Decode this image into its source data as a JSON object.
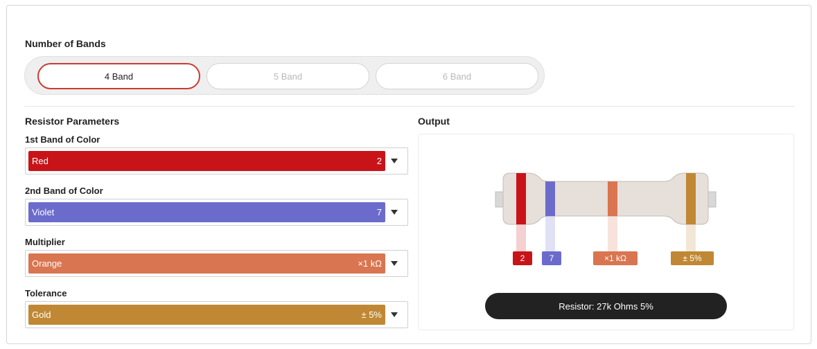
{
  "bands_section": {
    "title": "Number of Bands",
    "options": [
      {
        "label": "4 Band",
        "active": true
      },
      {
        "label": "5 Band",
        "active": false
      },
      {
        "label": "6 Band",
        "active": false
      }
    ]
  },
  "params": {
    "title": "Resistor Parameters",
    "fields": [
      {
        "label": "1st Band of Color",
        "color_name": "Red",
        "value": "2",
        "color": "#c81419"
      },
      {
        "label": "2nd Band of Color",
        "color_name": "Violet",
        "value": "7",
        "color": "#6b6bcc"
      },
      {
        "label": "Multiplier",
        "color_name": "Orange",
        "value": "×1 kΩ",
        "color": "#d97550"
      },
      {
        "label": "Tolerance",
        "color_name": "Gold",
        "value": "± 5%",
        "color": "#c08834"
      }
    ]
  },
  "output": {
    "title": "Output",
    "tags": [
      "2",
      "7",
      "×1 kΩ",
      "± 5%"
    ],
    "result": "Resistor: 27k Ohms 5%"
  },
  "colors": {
    "accent": "#cc3a31",
    "body": "#e6dfda"
  }
}
